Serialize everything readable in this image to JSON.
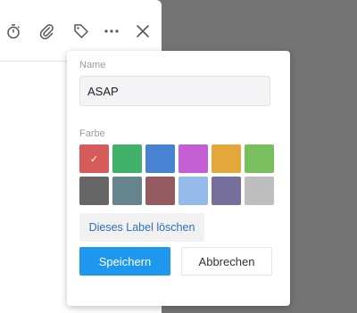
{
  "toolbar": {
    "icons": [
      "timer-icon",
      "paperclip-icon",
      "tag-icon",
      "more-icon",
      "close-icon"
    ]
  },
  "popover": {
    "name_label": "Name",
    "name_value": "ASAP",
    "color_label": "Farbe",
    "colors": [
      "#d65b5b",
      "#41b169",
      "#4783d2",
      "#c45ed3",
      "#e3a73c",
      "#7abf5e",
      "#666666",
      "#66858f",
      "#955a5f",
      "#94baea",
      "#766f9c",
      "#bebebe"
    ],
    "selected_color_index": 0,
    "selected_mark": "✓",
    "delete_label": "Dieses Label löschen",
    "save_label": "Speichern",
    "cancel_label": "Abbrechen"
  }
}
